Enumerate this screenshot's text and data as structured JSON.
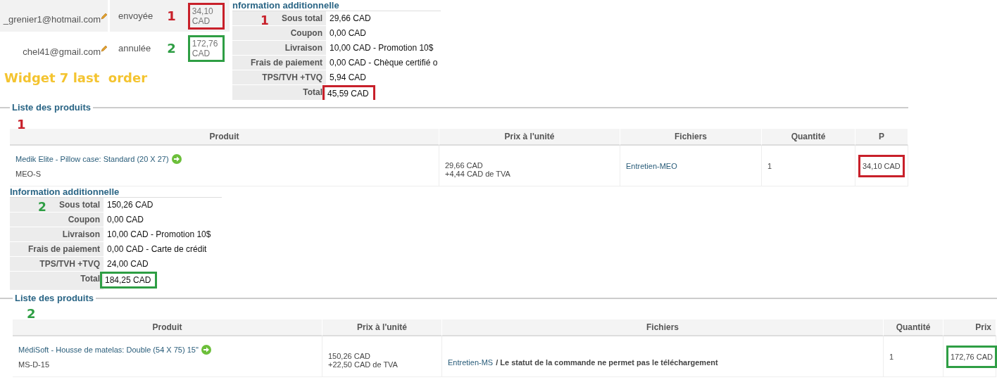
{
  "orders": [
    {
      "email": "_grenier1@hotmail.com",
      "status": "envoyée",
      "badge": "1",
      "amount": "34,10 CAD",
      "color": "#c8202a"
    },
    {
      "email": "chel41@gmail.com",
      "status": "annulée",
      "badge": "2",
      "amount": "172,76 CAD",
      "color": "#2e9e44"
    }
  ],
  "annotation": "Widget 7 last  order",
  "details": [
    {
      "badge": "1",
      "products_badge": "1",
      "color": "#c8202a",
      "info_title": "nformation additionnelle",
      "summary": [
        {
          "label": "Sous total",
          "value": "29,66 CAD",
          "highlighted": false
        },
        {
          "label": "Coupon",
          "value": "0,00 CAD",
          "highlighted": false
        },
        {
          "label": "Livraison",
          "value": "10,00 CAD - Promotion 10$",
          "highlighted": false
        },
        {
          "label": "Frais de paiement",
          "value": "0,00 CAD - Chèque certifié o",
          "highlighted": false
        },
        {
          "label": "TPS/TVH +TVQ",
          "value": "5,94 CAD",
          "highlighted": false
        },
        {
          "label": "Total",
          "value": "45,59 CAD",
          "highlighted": true
        }
      ],
      "products_title": "Liste des produits",
      "columns": [
        "Produit",
        "Prix à l'unité",
        "Fichiers",
        "Quantité",
        "P"
      ],
      "rows": [
        {
          "product": "Medik Elite - Pillow case: Standard (20 X 27)",
          "sku": "MEO-S",
          "unit_price": "29,66 CAD",
          "tax": "+4,44 CAD de TVA",
          "file": "Entretien-MEO",
          "quantity": "1",
          "price": "34,10 CAD",
          "highlighted": true
        }
      ]
    },
    {
      "badge": "2",
      "products_badge": "2",
      "color": "#2e9e44",
      "info_title": "Information additionnelle",
      "summary": [
        {
          "label": "Sous total",
          "value": "150,26 CAD",
          "highlighted": false
        },
        {
          "label": "Coupon",
          "value": "0,00 CAD",
          "highlighted": false
        },
        {
          "label": "Livraison",
          "value": "10,00 CAD - Promotion 10$",
          "highlighted": false
        },
        {
          "label": "Frais de paiement",
          "value": "0,00 CAD - Carte de crédit",
          "highlighted": false
        },
        {
          "label": "TPS/TVH +TVQ",
          "value": "24,00 CAD",
          "highlighted": false
        },
        {
          "label": "Total",
          "value": "184,25 CAD",
          "highlighted": true
        }
      ],
      "products_title": "Liste des produits",
      "columns": [
        "Produit",
        "Prix à l'unité",
        "Fichiers",
        "Quantité",
        "Prix"
      ],
      "rows": [
        {
          "product": "MédiSoft - Housse de matelas: Double (54 X 75) 15\"",
          "sku": "MS-D-15",
          "unit_price": "150,26 CAD",
          "tax": "+22,50 CAD de TVA",
          "file": "Entretien-MS",
          "file_note": "/ Le statut de la commande ne permet pas le téléchargement",
          "quantity": "1",
          "price": "172,76 CAD",
          "highlighted": true
        }
      ]
    }
  ]
}
